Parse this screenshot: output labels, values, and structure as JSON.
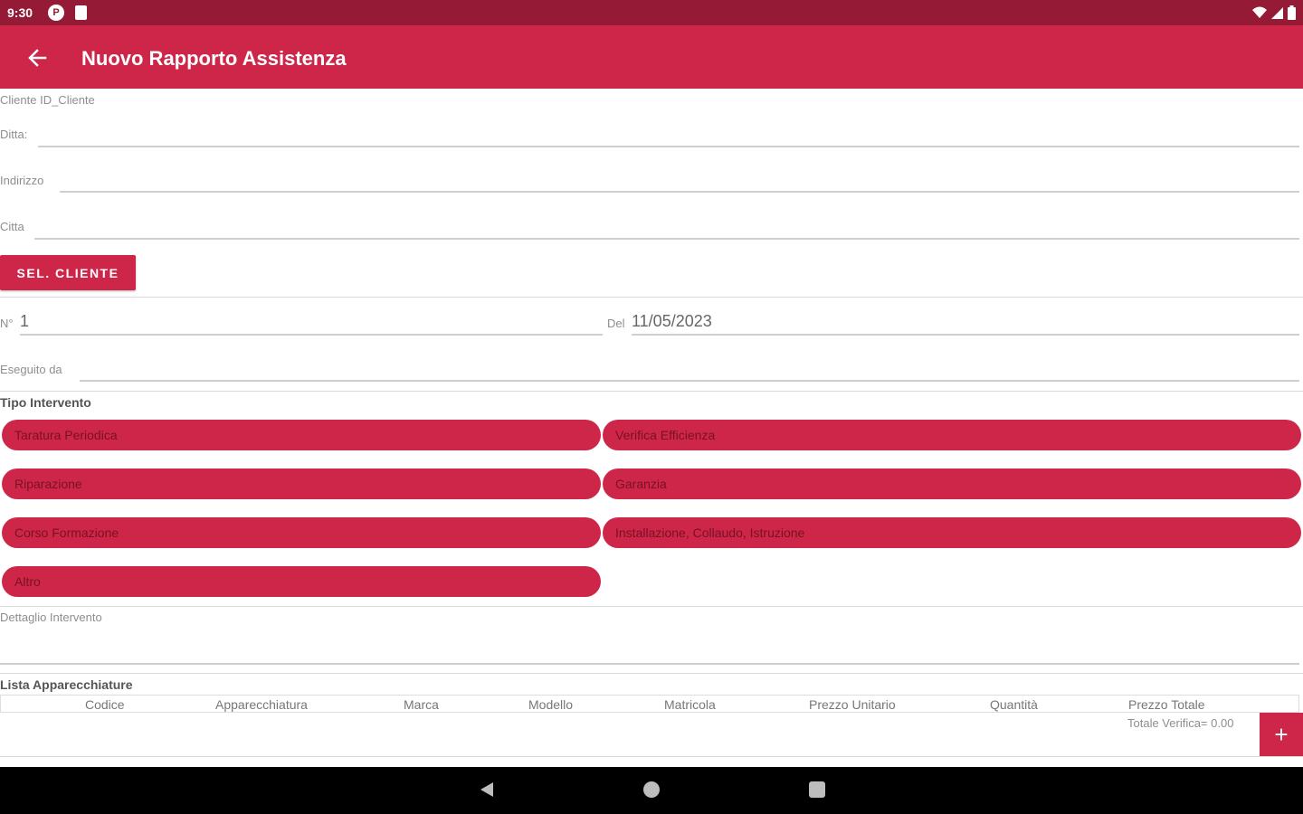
{
  "status_bar": {
    "time": "9:30",
    "p_icon_glyph": "P"
  },
  "app_bar": {
    "title": "Nuovo Rapporto Assistenza"
  },
  "form": {
    "client_id_label": "Cliente ID_Cliente",
    "ditta_label": "Ditta:",
    "indirizzo_label": "Indirizzo",
    "citta_label": "Citta",
    "select_client_button": "SEL. CLIENTE",
    "numero_label": "N°",
    "numero_value": "1",
    "del_label": "Del",
    "del_value": "11/05/2023",
    "eseguito_label": "Eseguito da"
  },
  "tipo_intervento": {
    "heading": "Tipo Intervento",
    "options": [
      "Taratura Periodica",
      "Verifica Efficienza",
      "Riparazione",
      "Garanzia",
      "Corso Formazione",
      "Installazione, Collaudo, Istruzione",
      "Altro"
    ]
  },
  "dettaglio": {
    "label": "Dettaglio Intervento"
  },
  "lista": {
    "heading": "Lista Apparecchiature",
    "columns": [
      "Codice",
      "Apparecchiatura",
      "Marca",
      "Modello",
      "Matricola",
      "Prezzo Unitario",
      "Quantità",
      "Prezzo Totale"
    ],
    "total_text": "Totale Verifica= 0.00",
    "fab_glyph": "+"
  },
  "colors": {
    "primary": "#cd2649",
    "status_bar": "#951a36",
    "nav_bar": "#000000"
  }
}
